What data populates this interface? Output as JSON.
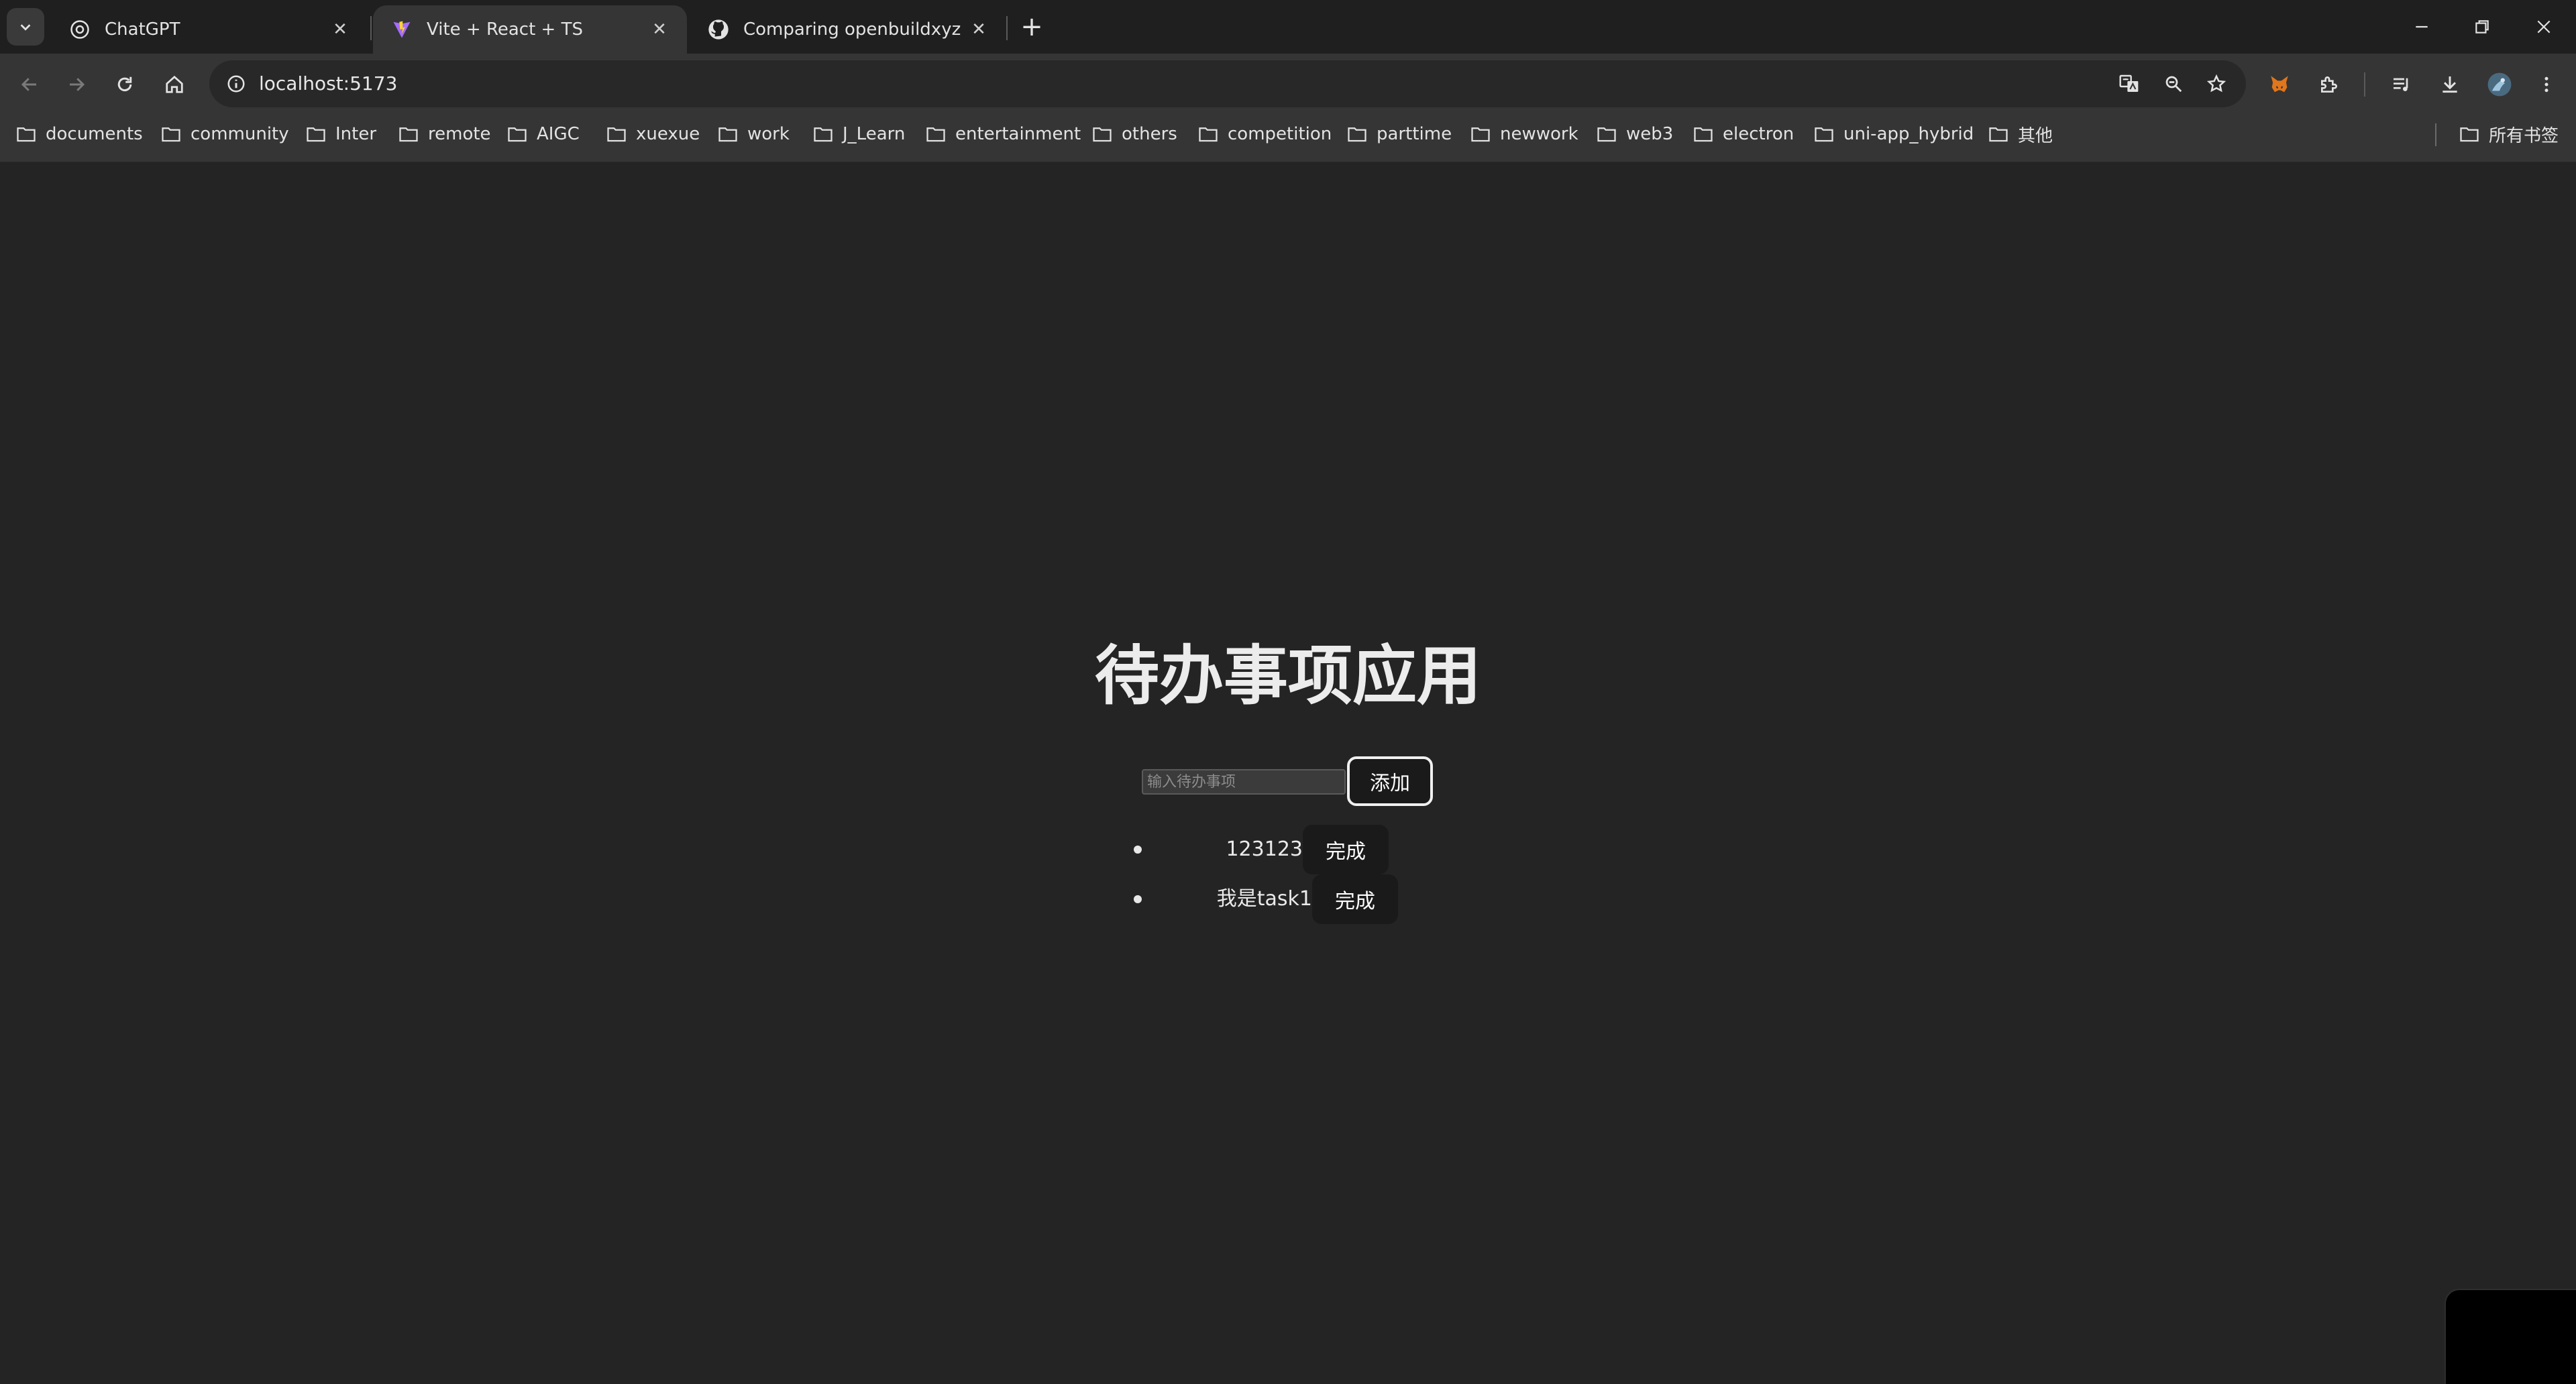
{
  "browser": {
    "tabs": [
      {
        "title": "ChatGPT",
        "icon": "chatgpt-icon",
        "active": false
      },
      {
        "title": "Vite + React + TS",
        "icon": "vite-icon",
        "active": true
      },
      {
        "title": "Comparing openbuildxyz:ma",
        "icon": "github-icon",
        "active": false
      }
    ],
    "new_tab_label": "+",
    "url": "localhost:5173"
  },
  "bookmarks": {
    "items": [
      {
        "label": "documents"
      },
      {
        "label": "community"
      },
      {
        "label": "Inter"
      },
      {
        "label": "remote"
      },
      {
        "label": "AIGC"
      },
      {
        "label": "xuexue"
      },
      {
        "label": "work"
      },
      {
        "label": "J_Learn"
      },
      {
        "label": "entertainment"
      },
      {
        "label": "others"
      },
      {
        "label": "competition"
      },
      {
        "label": "parttime"
      },
      {
        "label": "newwork"
      },
      {
        "label": "web3"
      },
      {
        "label": "electron"
      },
      {
        "label": "uni-app_hybrid"
      },
      {
        "label": "其他"
      }
    ],
    "all_bookmarks_label": "所有书签"
  },
  "app": {
    "title": "待办事项应用",
    "input_placeholder": "输入待办事项",
    "add_button": "添加",
    "todos": [
      {
        "text": "123123",
        "button": "完成"
      },
      {
        "text": "我是task1",
        "button": "完成"
      }
    ]
  }
}
